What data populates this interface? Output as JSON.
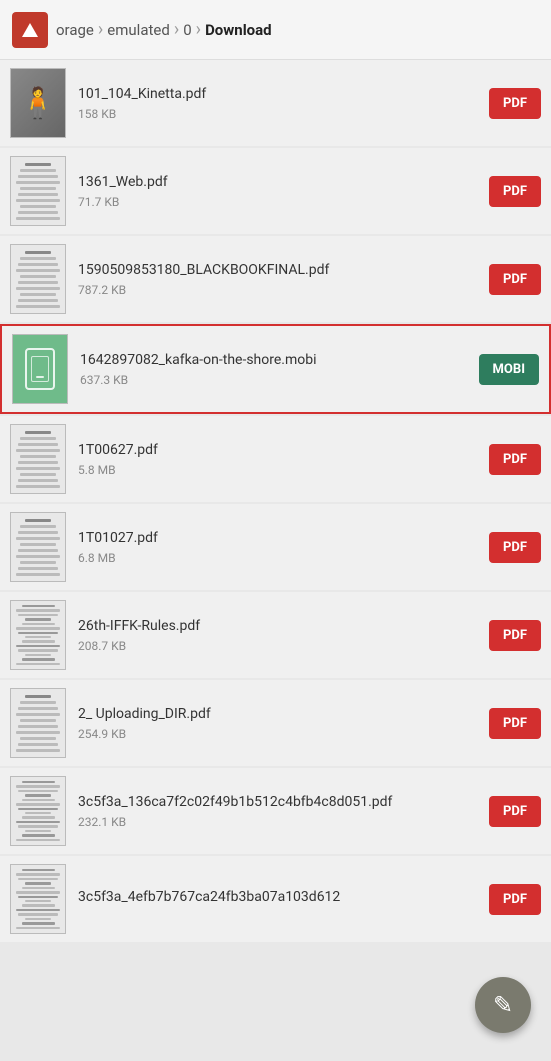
{
  "header": {
    "app_icon": "file-manager-icon",
    "breadcrumb": [
      {
        "id": "storage",
        "label": "orage"
      },
      {
        "id": "emulated",
        "label": "emulated"
      },
      {
        "id": "zero",
        "label": "0"
      },
      {
        "id": "download",
        "label": "Download",
        "active": true
      }
    ]
  },
  "files": [
    {
      "id": "file-1",
      "name": "101_104_Kinetta.pdf",
      "size": "158 KB",
      "type": "PDF",
      "badge": "PDF",
      "badge_type": "pdf",
      "selected": false,
      "thumb_type": "photo"
    },
    {
      "id": "file-2",
      "name": "1361_Web.pdf",
      "size": "71.7 KB",
      "type": "PDF",
      "badge": "PDF",
      "badge_type": "pdf",
      "selected": false,
      "thumb_type": "striped"
    },
    {
      "id": "file-3",
      "name": "1590509853180_BLACKBOOKFINAL.pdf",
      "size": "787.2 KB",
      "type": "PDF",
      "badge": "PDF",
      "badge_type": "pdf",
      "selected": false,
      "thumb_type": "striped"
    },
    {
      "id": "file-4",
      "name": "1642897082_kafka-on-the-shore.mobi",
      "size": "637.3 KB",
      "type": "MOBI",
      "badge": "MOBI",
      "badge_type": "mobi",
      "selected": true,
      "thumb_type": "mobi"
    },
    {
      "id": "file-5",
      "name": "1T00627.pdf",
      "size": "5.8 MB",
      "type": "PDF",
      "badge": "PDF",
      "badge_type": "pdf",
      "selected": false,
      "thumb_type": "striped"
    },
    {
      "id": "file-6",
      "name": "1T01027.pdf",
      "size": "6.8 MB",
      "type": "PDF",
      "badge": "PDF",
      "badge_type": "pdf",
      "selected": false,
      "thumb_type": "striped"
    },
    {
      "id": "file-7",
      "name": "26th-IFFK-Rules.pdf",
      "size": "208.7 KB",
      "type": "PDF",
      "badge": "PDF",
      "badge_type": "pdf",
      "selected": false,
      "thumb_type": "striped_dense"
    },
    {
      "id": "file-8",
      "name": "2_ Uploading_DIR.pdf",
      "size": "254.9 KB",
      "type": "PDF",
      "badge": "PDF",
      "badge_type": "pdf",
      "selected": false,
      "thumb_type": "striped"
    },
    {
      "id": "file-9",
      "name": "3c5f3a_136ca7f2c02f49b1b512c4bfb4c8d051.pdf",
      "size": "232.1 KB",
      "type": "PDF",
      "badge": "PDF",
      "badge_type": "pdf",
      "selected": false,
      "thumb_type": "striped_dense"
    },
    {
      "id": "file-10",
      "name": "3c5f3a_4efb7b767ca24fb3ba07a103d612",
      "size": "",
      "type": "PDF",
      "badge": "PDF",
      "badge_type": "pdf",
      "selected": false,
      "thumb_type": "striped_dense"
    }
  ],
  "fab": {
    "icon": "edit-icon",
    "label": "✎"
  }
}
